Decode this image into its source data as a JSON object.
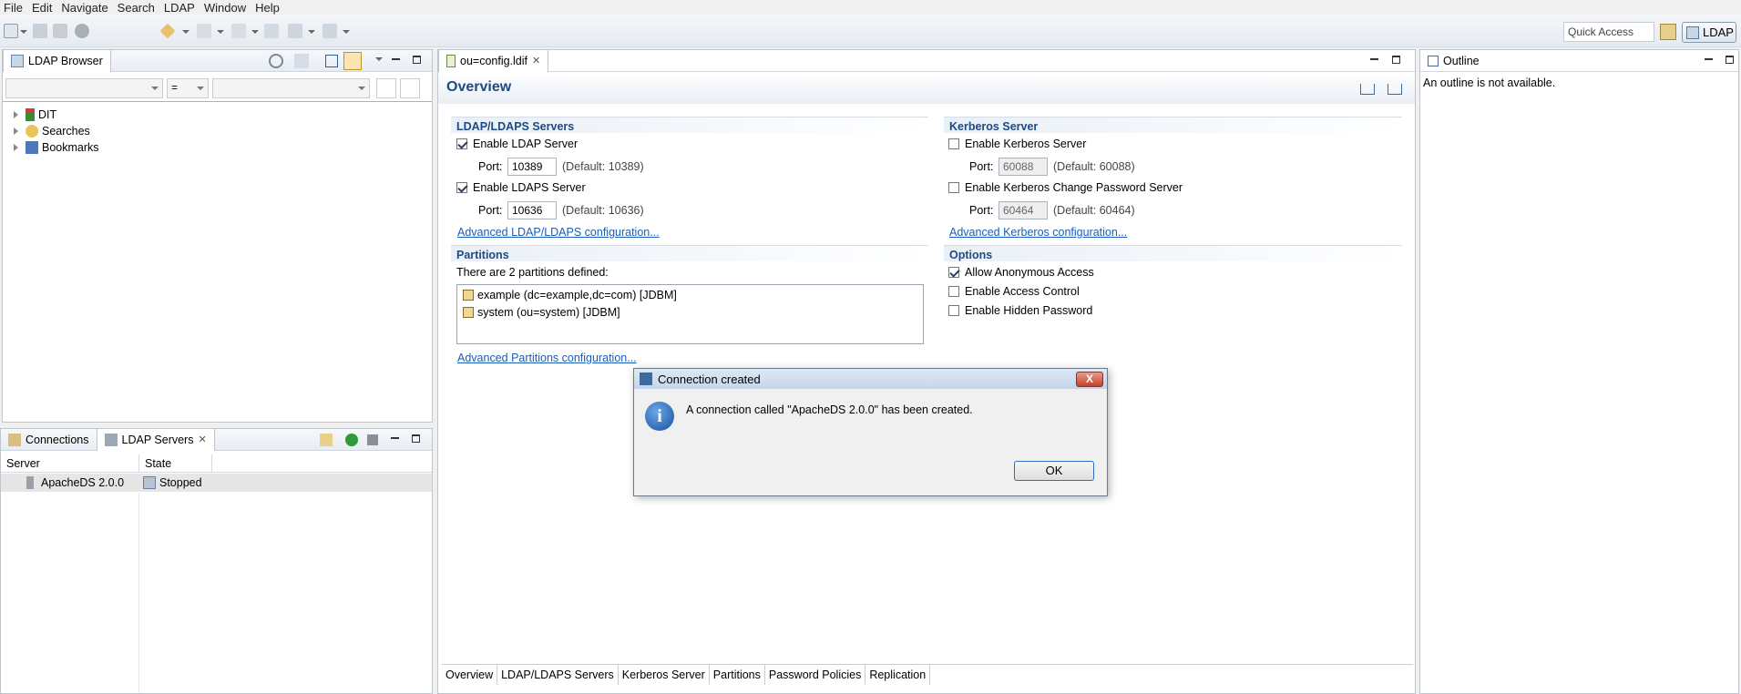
{
  "menu": [
    "File",
    "Edit",
    "Navigate",
    "Search",
    "LDAP",
    "Window",
    "Help"
  ],
  "toolbar": {
    "quick_access": "Quick Access",
    "perspective": "LDAP"
  },
  "browser": {
    "title": "LDAP Browser",
    "filter_operator": "=",
    "tree": [
      "DIT",
      "Searches",
      "Bookmarks"
    ]
  },
  "servers_panel": {
    "tabs": [
      "Connections",
      "LDAP Servers"
    ],
    "columns": [
      "Server",
      "State"
    ],
    "rows": [
      {
        "server": "ApacheDS 2.0.0",
        "state": "Stopped"
      }
    ]
  },
  "editor": {
    "tab": "ou=config.ldif",
    "title": "Overview",
    "ldap_section": {
      "title": "LDAP/LDAPS Servers",
      "enable_ldap": "Enable LDAP Server",
      "ldap_port_label": "Port:",
      "ldap_port": "10389",
      "ldap_default": "(Default: 10389)",
      "enable_ldaps": "Enable LDAPS Server",
      "ldaps_port_label": "Port:",
      "ldaps_port": "10636",
      "ldaps_default": "(Default: 10636)",
      "advanced_link": "Advanced LDAP/LDAPS configuration..."
    },
    "kerberos_section": {
      "title": "Kerberos Server",
      "enable_kerberos": "Enable Kerberos Server",
      "kerberos_port_label": "Port:",
      "kerberos_port": "60088",
      "kerberos_default": "(Default: 60088)",
      "enable_change_pw": "Enable Kerberos Change Password Server",
      "change_pw_port_label": "Port:",
      "change_pw_port": "60464",
      "change_pw_default": "(Default: 60464)",
      "advanced_link": "Advanced Kerberos configuration..."
    },
    "partitions_section": {
      "title": "Partitions",
      "summary": "There are 2 partitions defined:",
      "items": [
        "example (dc=example,dc=com) [JDBM]",
        "system (ou=system) [JDBM]"
      ],
      "advanced_link": "Advanced Partitions configuration..."
    },
    "options_section": {
      "title": "Options",
      "allow_anonymous": "Allow Anonymous Access",
      "access_control": "Enable Access Control",
      "hidden_password": "Enable Hidden Password"
    },
    "bottom_tabs": [
      "Overview",
      "LDAP/LDAPS Servers",
      "Kerberos Server",
      "Partitions",
      "Password Policies",
      "Replication"
    ]
  },
  "outline": {
    "title": "Outline",
    "message": "An outline is not available."
  },
  "dialog": {
    "title": "Connection created",
    "message": "A connection called \"ApacheDS 2.0.0\" has been created.",
    "ok": "OK",
    "close": "X"
  }
}
